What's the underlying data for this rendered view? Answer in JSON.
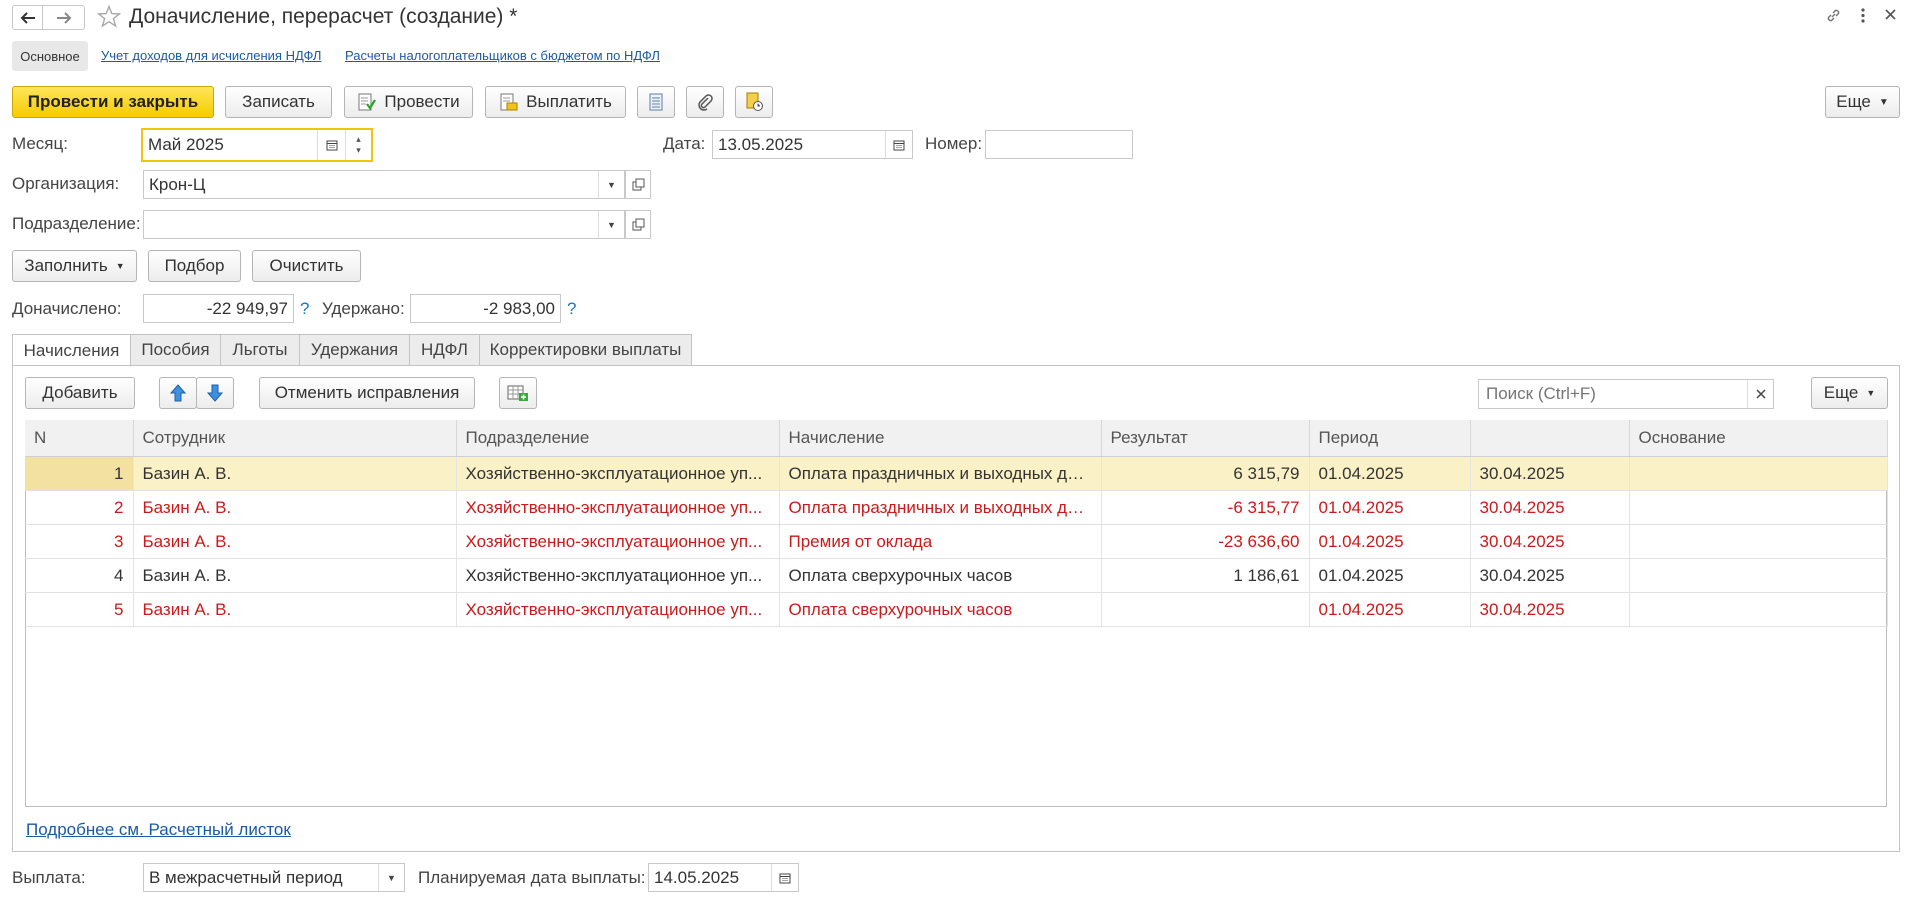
{
  "window": {
    "title": "Доначисление, перерасчет (создание) *"
  },
  "nav": {
    "items": [
      "Основное",
      "Учет доходов для исчисления НДФЛ",
      "Расчеты налогоплательщиков с бюджетом по НДФЛ"
    ]
  },
  "toolbar": {
    "post_close": "Провести и закрыть",
    "save": "Записать",
    "post": "Провести",
    "pay": "Выплатить",
    "more": "Еще"
  },
  "form": {
    "month_label": "Месяц:",
    "month_value": "Май 2025",
    "date_label": "Дата:",
    "date_value": "13.05.2025",
    "number_label": "Номер:",
    "number_value": "",
    "org_label": "Организация:",
    "org_value": "Крон-Ц",
    "dept_label": "Подразделение:",
    "dept_value": "",
    "fill_btn": "Заполнить",
    "select_btn": "Подбор",
    "clear_btn": "Очистить",
    "accrued_label": "Доначислено:",
    "accrued_value": "-22 949,97",
    "withheld_label": "Удержано:",
    "withheld_value": "-2 983,00",
    "help": "?"
  },
  "tabs": [
    "Начисления",
    "Пособия",
    "Льготы",
    "Удержания",
    "НДФЛ",
    "Корректировки выплаты"
  ],
  "panel": {
    "add_btn": "Добавить",
    "cancel_fix_btn": "Отменить исправления",
    "search_placeholder": "Поиск (Ctrl+F)",
    "more": "Еще"
  },
  "table": {
    "columns": [
      "N",
      "Сотрудник",
      "Подразделение",
      "Начисление",
      "Результат",
      "Период",
      "",
      "Основание"
    ],
    "rows": [
      {
        "n": "1",
        "employee": "Базин А. В.",
        "dept": "Хозяйственно-эксплуатационное уп...",
        "accrual": "Оплата праздничных и выходных дней",
        "result": "6 315,79",
        "from": "01.04.2025",
        "to": "30.04.2025",
        "basis": "",
        "style": "sel"
      },
      {
        "n": "2",
        "employee": "Базин А. В.",
        "dept": "Хозяйственно-эксплуатационное уп...",
        "accrual": "Оплата праздничных и выходных дней",
        "result": "-6 315,77",
        "from": "01.04.2025",
        "to": "30.04.2025",
        "basis": "",
        "style": "red"
      },
      {
        "n": "3",
        "employee": "Базин А. В.",
        "dept": "Хозяйственно-эксплуатационное уп...",
        "accrual": "Премия от оклада",
        "result": "-23 636,60",
        "from": "01.04.2025",
        "to": "30.04.2025",
        "basis": "",
        "style": "red"
      },
      {
        "n": "4",
        "employee": "Базин А. В.",
        "dept": "Хозяйственно-эксплуатационное уп...",
        "accrual": "Оплата сверхурочных часов",
        "result": "1 186,61",
        "from": "01.04.2025",
        "to": "30.04.2025",
        "basis": "",
        "style": ""
      },
      {
        "n": "5",
        "employee": "Базин А. В.",
        "dept": "Хозяйственно-эксплуатационное уп...",
        "accrual": "Оплата сверхурочных часов",
        "result": "",
        "from": "01.04.2025",
        "to": "30.04.2025",
        "basis": "",
        "style": "red"
      }
    ]
  },
  "footer": {
    "details_link": "Подробнее см. Расчетный листок",
    "payment_label": "Выплата:",
    "payment_value": "В межрасчетный период",
    "plan_date_label": "Планируемая дата выплаты:",
    "plan_date_value": "14.05.2025"
  }
}
